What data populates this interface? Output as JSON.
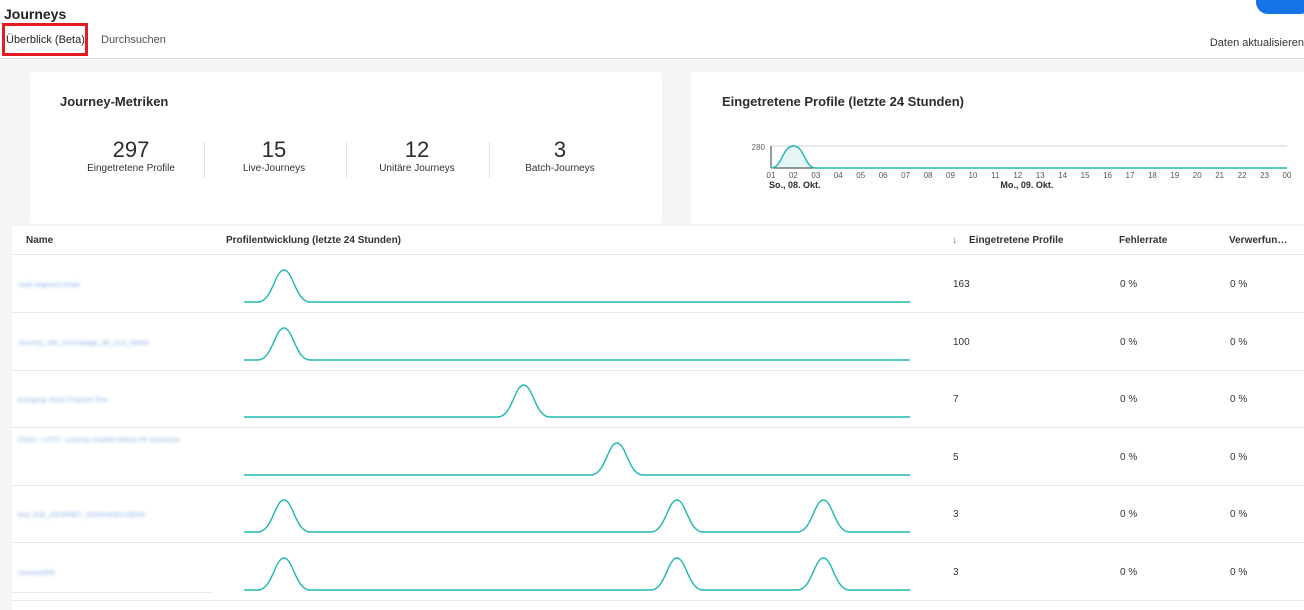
{
  "header": {
    "title": "Journeys",
    "tabs": [
      {
        "label": "Überblick (Beta)",
        "active": true
      },
      {
        "label": "Durchsuchen",
        "active": false
      }
    ],
    "refresh_label": "Daten aktualisieren"
  },
  "metrics_card": {
    "title": "Journey-Metriken",
    "metrics": [
      {
        "value": "297",
        "label": "Eingetretene Profile"
      },
      {
        "value": "15",
        "label": "Live-Journeys"
      },
      {
        "value": "12",
        "label": "Unitäre Journeys"
      },
      {
        "value": "3",
        "label": "Batch-Journeys"
      }
    ]
  },
  "entered_card": {
    "title": "Eingetretene Profile (letzte 24 Stunden)",
    "chart_data": {
      "type": "area",
      "ytick": "280",
      "x_ticks": [
        "01",
        "02",
        "03",
        "04",
        "05",
        "06",
        "07",
        "08",
        "09",
        "10",
        "11",
        "12",
        "13",
        "14",
        "15",
        "16",
        "17",
        "18",
        "19",
        "20",
        "21",
        "22",
        "23",
        "00"
      ],
      "date_labels": [
        "So., 08. Okt.",
        "Mo., 09. Okt."
      ],
      "values": [
        0,
        280,
        0,
        0,
        0,
        0,
        0,
        0,
        0,
        0,
        0,
        0,
        0,
        0,
        0,
        0,
        0,
        0,
        0,
        0,
        0,
        0,
        0,
        0
      ]
    }
  },
  "table": {
    "columns": {
      "name": "Name",
      "trend": "Profilentwicklung (letzte 24 Stunden)",
      "sort_icon": "sort-descending-icon",
      "entered": "Eingetretene Profile",
      "error": "Fehlerrate",
      "discard": "Verwerfun…"
    },
    "rows": [
      {
        "name": "read segment email",
        "entered": "163",
        "error": "0 %",
        "discard": "0 %",
        "peaks": [
          0.06
        ]
      },
      {
        "name": "Journey_site_microspage_db_cust_delete",
        "entered": "100",
        "error": "0 %",
        "discard": "0 %",
        "peaks": [
          0.06
        ]
      },
      {
        "name": "escaping: Multi Channel Test",
        "entered": "7",
        "error": "0 %",
        "discard": "0 %",
        "peaks": [
          0.42
        ]
      },
      {
        "name": "DiDev - UTPJ - journey created before PF activation",
        "entered": "5",
        "error": "0 %",
        "discard": "0 %",
        "peaks": [
          0.56
        ]
      },
      {
        "name": "test_IGB_JOURNEY_NONHANDLEBAN",
        "entered": "3",
        "error": "0 %",
        "discard": "0 %",
        "peaks": [
          0.06,
          0.65,
          0.87
        ]
      },
      {
        "name": "Journey006",
        "entered": "3",
        "error": "0 %",
        "discard": "0 %",
        "peaks": [
          0.06,
          0.65,
          0.87
        ]
      }
    ]
  },
  "colors": {
    "accent": "#1473e6",
    "chart_line": "#1fb8b1",
    "highlight": "#e51b23"
  }
}
